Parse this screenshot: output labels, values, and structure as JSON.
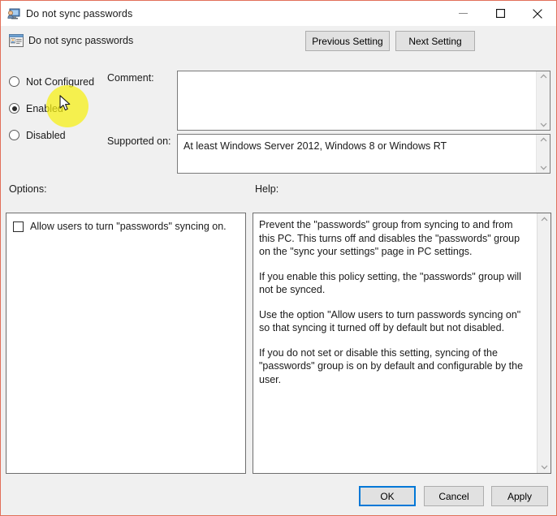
{
  "window": {
    "title": "Do not sync passwords",
    "title_icon": "monitor-user-icon",
    "policy_icon": "policy-setting-icon",
    "policy_name": "Do not sync passwords",
    "border_color": "#e2705a",
    "background_color": "#f0f0f0"
  },
  "window_controls": {
    "minimize": "minimize-icon",
    "maximize": "maximize-icon",
    "close": "close-icon"
  },
  "nav": {
    "previous_label": "Previous Setting",
    "next_label": "Next Setting"
  },
  "state_options": [
    {
      "label": "Not Configured",
      "selected": false
    },
    {
      "label": "Enabled",
      "selected": true
    },
    {
      "label": "Disabled",
      "selected": false
    }
  ],
  "comment": {
    "label": "Comment:",
    "value": "",
    "scroll_up_icon": "chevron-up-icon",
    "scroll_down_icon": "chevron-down-icon"
  },
  "supported_on": {
    "label": "Supported on:",
    "value": "At least Windows Server 2012, Windows 8 or Windows RT",
    "scroll_up_icon": "chevron-up-icon",
    "scroll_down_icon": "chevron-down-icon"
  },
  "options": {
    "label": "Options:",
    "checkbox_label": "Allow users to turn \"passwords\" syncing on.",
    "checkbox_checked": false
  },
  "help": {
    "label": "Help:",
    "paragraphs": [
      "Prevent the \"passwords\" group from syncing to and from this PC.  This turns off and disables the \"passwords\" group on the \"sync your settings\" page in PC settings.",
      "If you enable this policy setting, the \"passwords\" group will not be synced.",
      "Use the option \"Allow users to turn passwords syncing on\" so that syncing it turned off by default but not disabled.",
      "If you do not set or disable this setting, syncing of the \"passwords\" group is on by default and configurable by the user."
    ],
    "scroll_up_icon": "chevron-up-icon",
    "scroll_down_icon": "chevron-down-icon"
  },
  "footer": {
    "ok_label": "OK",
    "cancel_label": "Cancel",
    "apply_label": "Apply",
    "focus_color": "#0078d7"
  },
  "cursor": {
    "highlight_color": "#f7f00f",
    "type": "arrow-pointer"
  }
}
